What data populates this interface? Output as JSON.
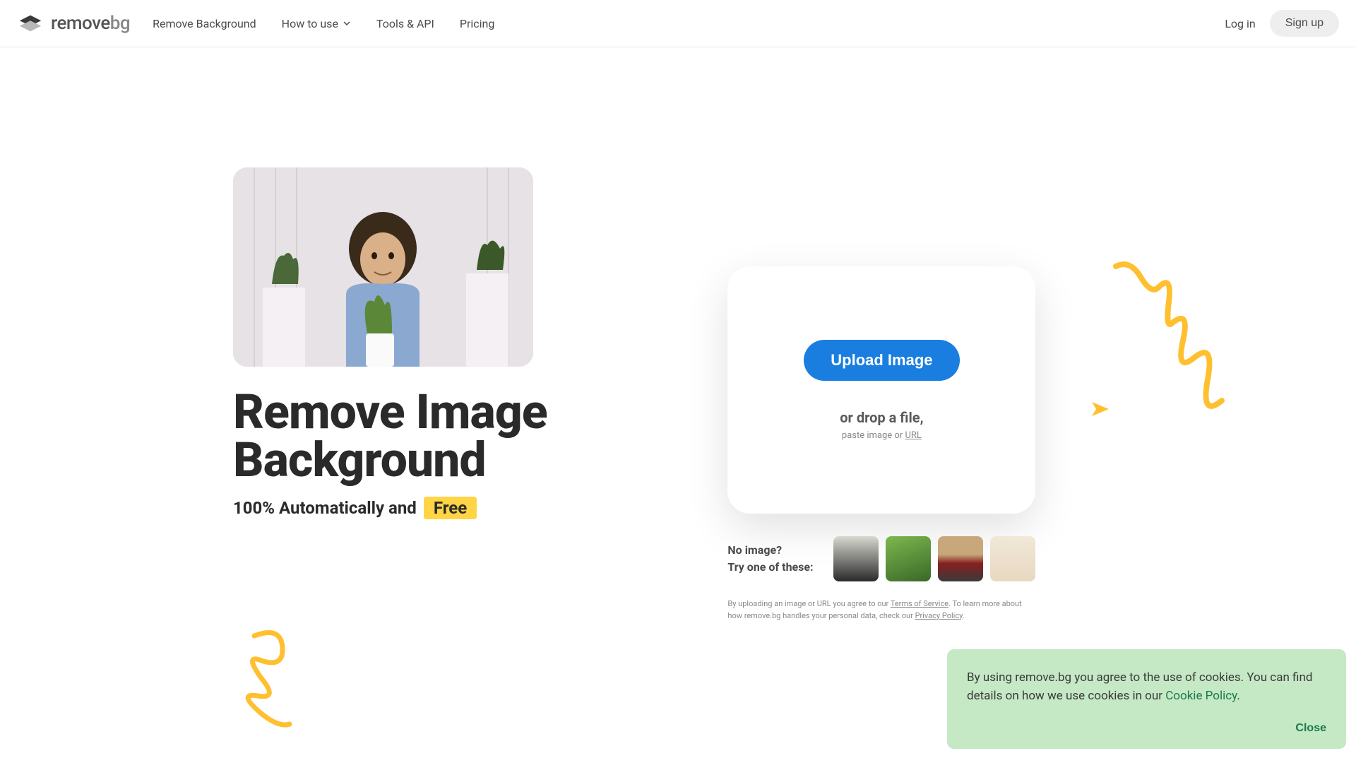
{
  "header": {
    "logo_text1": "remove",
    "logo_text2": "bg",
    "nav": {
      "remove_bg": "Remove Background",
      "how_to_use": "How to use",
      "tools_api": "Tools & API",
      "pricing": "Pricing"
    },
    "login": "Log in",
    "signup": "Sign up"
  },
  "hero": {
    "title_line1": "Remove Image",
    "title_line2": "Background",
    "subtitle_prefix": "100% Automatically and",
    "subtitle_badge": "Free"
  },
  "upload": {
    "button": "Upload Image",
    "drop_text": "or drop a file,",
    "paste_prefix": "paste image or ",
    "paste_url": "URL"
  },
  "samples": {
    "line1": "No image?",
    "line2": "Try one of these:"
  },
  "disclaimer": {
    "prefix": "By uploading an image or URL you agree to our ",
    "tos": "Terms of Service",
    "middle": ". To learn more about how remove.bg handles your personal data, check our ",
    "privacy": "Privacy Policy",
    "suffix": "."
  },
  "cookie": {
    "text_prefix": "By using remove.bg you agree to the use of cookies. You can find details on how we use cookies in our ",
    "policy_link": "Cookie Policy",
    "text_suffix": ".",
    "close": "Close"
  }
}
